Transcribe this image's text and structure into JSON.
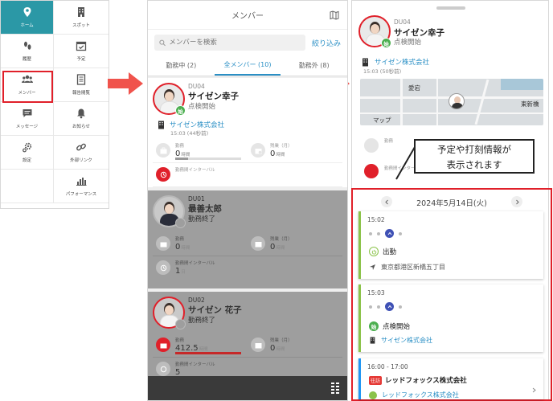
{
  "menu": {
    "items": [
      {
        "label": "ホーム",
        "icon": "home-icon",
        "active": true
      },
      {
        "label": "スポット",
        "icon": "building-icon"
      },
      {
        "label": "履歴",
        "icon": "footprints-icon"
      },
      {
        "label": "予定",
        "icon": "calendar-icon"
      },
      {
        "label": "メンバー",
        "icon": "members-icon"
      },
      {
        "label": "報告閲覧",
        "icon": "document-icon"
      },
      {
        "label": "メッセージ",
        "icon": "message-icon"
      },
      {
        "label": "お知らせ",
        "icon": "bell-icon"
      },
      {
        "label": "設定",
        "icon": "gear-icon"
      },
      {
        "label": "外部リンク",
        "icon": "link-icon"
      },
      {
        "label": "",
        "icon": ""
      },
      {
        "label": "パフォーマンス",
        "icon": "chart-icon"
      }
    ]
  },
  "list": {
    "title": "メンバー",
    "search_placeholder": "メンバーを検索",
    "filter_label": "絞り込み",
    "tabs": [
      "勤務中 (2)",
      "全メンバー (10)",
      "勤務外 (8)"
    ],
    "members": [
      {
        "id": "DU04",
        "name": "サイゼン幸子",
        "status": "点検開始",
        "badge": "始",
        "company": "サイゼン株式会社",
        "company_time": "15:03 (44秒前)",
        "work_label": "勤務",
        "work_value": "0",
        "work_unit": "時間",
        "overtime_label": "残業（月）",
        "overtime_value": "0",
        "overtime_unit": "時間",
        "interval_label": "勤務間インターバル",
        "interval_value": "",
        "interval_unit": ""
      },
      {
        "id": "DU01",
        "name": "最善太郎",
        "status": "勤務終了",
        "badge": "",
        "work_label": "勤務",
        "work_value": "0",
        "work_unit": "時間",
        "overtime_label": "残業（月）",
        "overtime_value": "0",
        "overtime_unit": "時間",
        "interval_label": "勤務間インターバル",
        "interval_value": "1",
        "interval_unit": "日"
      },
      {
        "id": "DU02",
        "name": "サイゼン 花子",
        "status": "勤務終了",
        "badge": "",
        "work_label": "勤務",
        "work_value": "412.5",
        "work_unit": "時間",
        "overtime_label": "残業（月）",
        "overtime_value": "0",
        "overtime_unit": "時間",
        "interval_label": "勤務間インターバル",
        "interval_value": "5",
        "interval_unit": ""
      }
    ]
  },
  "detail": {
    "id": "DU04",
    "name": "サイゼン幸子",
    "status": "点検開始",
    "badge": "始",
    "company": "サイゼン株式会社",
    "company_time": "15:03 (50秒前)",
    "map_labels": {
      "area": "愛宕",
      "station": "東新橋",
      "map_brand": "マップ"
    },
    "work_label": "勤務",
    "interval_label": "勤務間インターバル",
    "callout": [
      "予定や打刻情報が",
      "表示されます"
    ],
    "date": "2024年5月14日(火)",
    "events": [
      {
        "time": "15:02",
        "title": "出勤",
        "sub": "東京都港区新橋五丁目",
        "color": "#8bc34a"
      },
      {
        "time": "15:03",
        "title": "点検開始",
        "badge": "始",
        "sub": "サイゼン株式会社",
        "color": "#8bc34a"
      },
      {
        "time": "16:00 - 17:00",
        "tag": "往訪",
        "title": "レッドフォックス株式会社",
        "sub": "レッドフォックス株式会社",
        "color": "#2196f3"
      }
    ]
  },
  "colors": {
    "accent": "#2b98a6",
    "highlight": "#e0202a",
    "link": "#2a8fc5",
    "arrow": "#f0534c"
  }
}
